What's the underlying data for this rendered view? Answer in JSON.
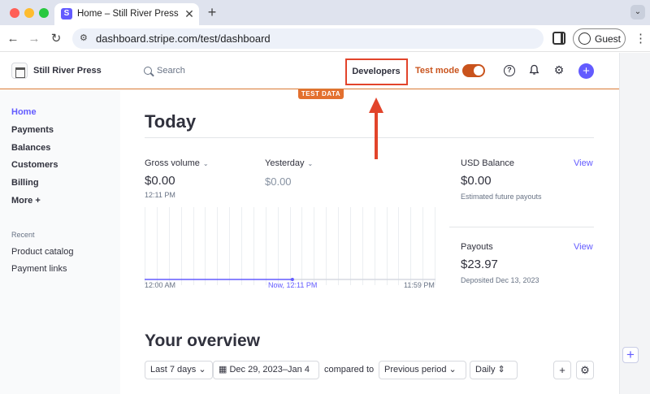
{
  "browser": {
    "tab_title": "Home – Still River Press – Stripe",
    "tab_favicon": "S",
    "tab_close": "✕",
    "new_tab": "+",
    "tab_menu": "⌄",
    "url": "dashboard.stripe.com/test/dashboard",
    "guest_label": "Guest",
    "nav_back": "←",
    "nav_forward": "→",
    "nav_reload": "↻",
    "kebab": "⋮",
    "site_info_icon": "⚙"
  },
  "topbar": {
    "account_name": "Still River Press",
    "search_placeholder": "Search",
    "developers_label": "Developers",
    "test_mode_label": "Test mode",
    "test_data_badge": "TEST DATA",
    "help_glyph": "?",
    "bell_glyph": "🔔",
    "gear_glyph": "⚙",
    "create_glyph": "+",
    "accent": "#635bff",
    "test_mode_color": "#c9531c",
    "toggle_on": true
  },
  "sidebar": {
    "items": [
      {
        "label": "Home",
        "active": true
      },
      {
        "label": "Payments",
        "active": false
      },
      {
        "label": "Balances",
        "active": false
      },
      {
        "label": "Customers",
        "active": false
      },
      {
        "label": "Billing",
        "active": false
      },
      {
        "label": "More +",
        "active": false
      }
    ],
    "recent_heading": "Recent",
    "recent_items": [
      "Product catalog",
      "Payment links"
    ]
  },
  "today": {
    "title": "Today",
    "gross_volume_label": "Gross volume",
    "gross_volume_value": "$0.00",
    "gross_volume_time": "12:11 PM",
    "yesterday_label": "Yesterday",
    "yesterday_value": "$0.00",
    "chevron": "⌄",
    "chart": {
      "x_start": "12:00 AM",
      "x_now": "Now, 12:11 PM",
      "x_end": "11:59 PM",
      "today_fraction_elapsed": 0.508,
      "series_color": "#635bff"
    },
    "usd_balance_label": "USD Balance",
    "usd_balance_value": "$0.00",
    "usd_balance_sub": "Estimated future payouts",
    "payouts_label": "Payouts",
    "payouts_value": "$23.97",
    "payouts_sub": "Deposited Dec 13, 2023",
    "view_label": "View"
  },
  "overview": {
    "title": "Your overview",
    "range_select": "Last 7 days",
    "date_range": "Dec 29, 2023–Jan 4",
    "compared_to": "compared to",
    "compare_select": "Previous period",
    "interval_select": "Daily",
    "add_glyph": "+",
    "settings_glyph": "⚙",
    "calendar_glyph": "▦"
  },
  "scrollbar": {
    "plus_glyph": "+"
  },
  "annotation": {
    "arrow_color": "#e2442b",
    "box_color": "#e2442b"
  }
}
